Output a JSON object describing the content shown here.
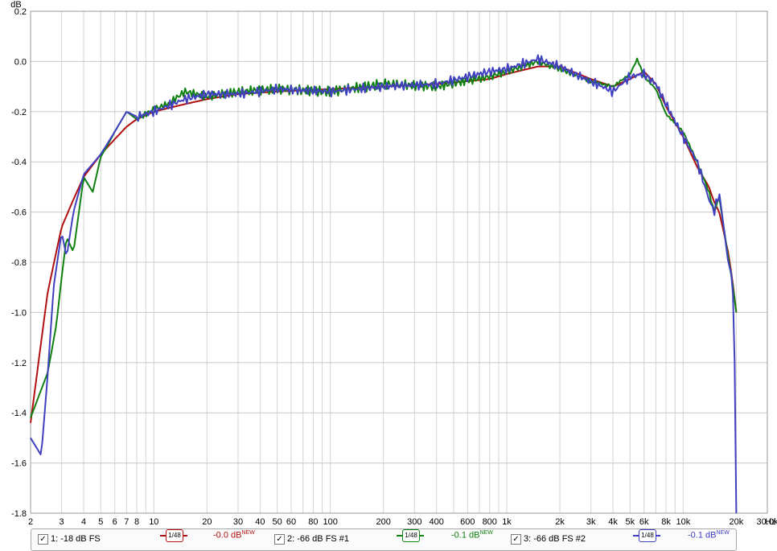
{
  "chart_data": {
    "type": "line",
    "ylabel": "dB",
    "xunit": "Hz",
    "xscale": "log",
    "xlim": [
      2,
      30000
    ],
    "ylim": [
      -1.8,
      0.2
    ],
    "x_ticks": [
      {
        "v": 2,
        "t": "2"
      },
      {
        "v": 3,
        "t": "3"
      },
      {
        "v": 4,
        "t": "4"
      },
      {
        "v": 5,
        "t": "5"
      },
      {
        "v": 6,
        "t": "6"
      },
      {
        "v": 7,
        "t": "7"
      },
      {
        "v": 8,
        "t": "8"
      },
      {
        "v": 10,
        "t": "10"
      },
      {
        "v": 20,
        "t": "20"
      },
      {
        "v": 30,
        "t": "30"
      },
      {
        "v": 40,
        "t": "40"
      },
      {
        "v": 50,
        "t": "50"
      },
      {
        "v": 60,
        "t": "60"
      },
      {
        "v": 80,
        "t": "80"
      },
      {
        "v": 100,
        "t": "100"
      },
      {
        "v": 200,
        "t": "200"
      },
      {
        "v": 300,
        "t": "300"
      },
      {
        "v": 400,
        "t": "400"
      },
      {
        "v": 600,
        "t": "600"
      },
      {
        "v": 800,
        "t": "800"
      },
      {
        "v": 1000,
        "t": "1k"
      },
      {
        "v": 2000,
        "t": "2k"
      },
      {
        "v": 3000,
        "t": "3k"
      },
      {
        "v": 4000,
        "t": "4k"
      },
      {
        "v": 5000,
        "t": "5k"
      },
      {
        "v": 6000,
        "t": "6k"
      },
      {
        "v": 8000,
        "t": "8k"
      },
      {
        "v": 10000,
        "t": "10k"
      },
      {
        "v": 20000,
        "t": "20k"
      },
      {
        "v": 30000,
        "t": "30.0k"
      }
    ],
    "y_ticks": [
      {
        "v": 0.2,
        "t": "0.2"
      },
      {
        "v": 0.0,
        "t": "0.0"
      },
      {
        "v": -0.2,
        "t": "-0.2"
      },
      {
        "v": -0.4,
        "t": "-0.4"
      },
      {
        "v": -0.6,
        "t": "-0.6"
      },
      {
        "v": -0.8,
        "t": "-0.8"
      },
      {
        "v": -1.0,
        "t": "-1.0"
      },
      {
        "v": -1.2,
        "t": "-1.2"
      },
      {
        "v": -1.4,
        "t": "-1.4"
      },
      {
        "v": -1.6,
        "t": "-1.6"
      },
      {
        "v": -1.8,
        "t": "-1.8"
      }
    ],
    "grid": true,
    "series": [
      {
        "name": "1: -18 dB FS",
        "color": "#b01010",
        "x": [
          2,
          2.5,
          3,
          3.5,
          4,
          5,
          6,
          7,
          8,
          10,
          15,
          20,
          30,
          50,
          100,
          200,
          400,
          800,
          1000,
          1500,
          2000,
          3000,
          4000,
          5000,
          6000,
          7000,
          8000,
          10000,
          12000,
          14000,
          15000,
          16000,
          18000,
          19000,
          20000
        ],
        "y": [
          -1.44,
          -0.92,
          -0.66,
          -0.55,
          -0.46,
          -0.37,
          -0.31,
          -0.26,
          -0.23,
          -0.2,
          -0.17,
          -0.15,
          -0.13,
          -0.12,
          -0.11,
          -0.1,
          -0.09,
          -0.07,
          -0.05,
          -0.02,
          -0.02,
          -0.07,
          -0.1,
          -0.07,
          -0.04,
          -0.09,
          -0.18,
          -0.3,
          -0.42,
          -0.5,
          -0.56,
          -0.6,
          -0.76,
          -0.87,
          -1.0
        ]
      },
      {
        "name": "2: -66 dB FS #1",
        "color": "#108010",
        "x": [
          2,
          2.5,
          2.8,
          3,
          3.2,
          3.5,
          4,
          4.5,
          5,
          5.5,
          6,
          7,
          8,
          9,
          10,
          12,
          15,
          20,
          30,
          50,
          100,
          200,
          400,
          800,
          1000,
          1500,
          2000,
          3000,
          4000,
          5000,
          5500,
          6000,
          7000,
          8000,
          10000,
          12000,
          14000,
          15000,
          16000,
          18000,
          19000,
          20000
        ],
        "y": [
          -1.42,
          -1.24,
          -1.05,
          -0.86,
          -0.7,
          -0.76,
          -0.46,
          -0.52,
          -0.38,
          -0.33,
          -0.28,
          -0.2,
          -0.23,
          -0.21,
          -0.19,
          -0.17,
          -0.12,
          -0.14,
          -0.12,
          -0.11,
          -0.12,
          -0.09,
          -0.1,
          -0.06,
          -0.04,
          0.0,
          -0.03,
          -0.08,
          -0.1,
          -0.05,
          0.01,
          -0.06,
          -0.11,
          -0.21,
          -0.28,
          -0.4,
          -0.52,
          -0.6,
          -0.54,
          -0.78,
          -0.88,
          -1.0
        ]
      },
      {
        "name": "3: -66 dB FS #2",
        "color": "#4040c0",
        "x": [
          2,
          2.3,
          2.5,
          2.7,
          3,
          3.2,
          3.5,
          4,
          5,
          6,
          7,
          8,
          10,
          15,
          20,
          30,
          50,
          100,
          200,
          400,
          800,
          1000,
          1500,
          2000,
          3000,
          4000,
          5000,
          6000,
          7000,
          8000,
          10000,
          12000,
          14000,
          15000,
          16000,
          18000,
          19000,
          19500,
          20000
        ],
        "y": [
          -1.5,
          -1.57,
          -1.25,
          -0.9,
          -0.68,
          -0.78,
          -0.6,
          -0.45,
          -0.37,
          -0.28,
          -0.2,
          -0.22,
          -0.2,
          -0.15,
          -0.13,
          -0.13,
          -0.11,
          -0.12,
          -0.1,
          -0.09,
          -0.04,
          -0.03,
          0.01,
          -0.02,
          -0.08,
          -0.12,
          -0.06,
          -0.05,
          -0.09,
          -0.17,
          -0.3,
          -0.4,
          -0.55,
          -0.6,
          -0.52,
          -0.8,
          -0.86,
          -1.1,
          -1.8
        ]
      }
    ]
  },
  "legend": [
    {
      "check": "✓",
      "label": "1: -18 dB FS",
      "smooth": "1/48",
      "offset": "-0.0 dB",
      "badge": "NEW",
      "color": "#b01010"
    },
    {
      "check": "✓",
      "label": "2: -66 dB FS #1",
      "smooth": "1/48",
      "offset": "-0.1 dB",
      "badge": "NEW",
      "color": "#108010"
    },
    {
      "check": "✓",
      "label": "3: -66 dB FS #2",
      "smooth": "1/48",
      "offset": "-0.1 dB",
      "badge": "NEW",
      "color": "#4040c0"
    }
  ]
}
